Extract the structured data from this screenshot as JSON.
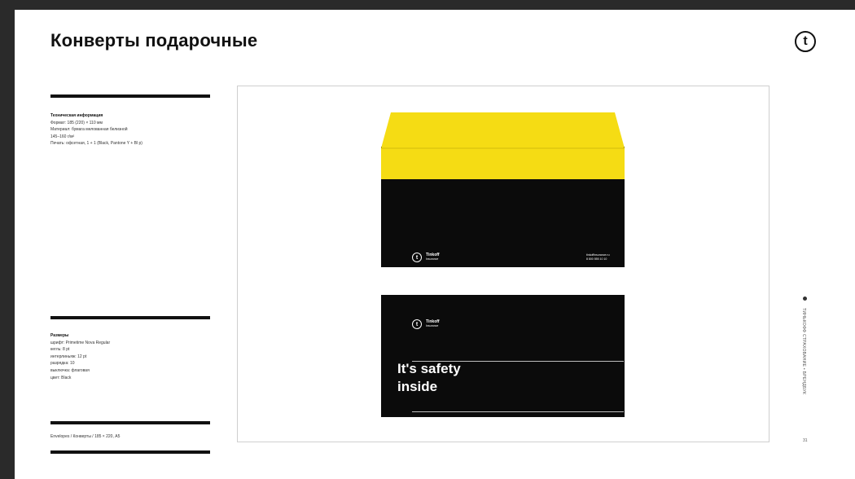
{
  "header": {
    "title": "Конверты подарочные",
    "brand_letter": "t"
  },
  "spec": {
    "heading": "Техническая информация",
    "lines": [
      "Формат: 185 (220) × 110 мм",
      "Материал: бумага мелованная белизной",
      "145–160 г/м²",
      "Печать: офсетная, 1 + 1 (Black, Pantone Y + Bl p)"
    ]
  },
  "typography": {
    "heading": "Размеры",
    "lines": [
      "шрифт: Primetime Nova Regular",
      "кегль: 8 pt",
      "интерлиньяж: 12 pt",
      "разрядка: 10",
      "выключка: флаговая",
      "цвет: Black"
    ]
  },
  "footer_note": "Envelopes / Конверты / 185 × 220, A5",
  "envelope": {
    "brand_name": "Tinkoff",
    "brand_sub": "Insurance",
    "contact_line1": "tinkoffinsurance.ru",
    "contact_line2": "8 800 555 10 10",
    "slogan_line1": "It's safety",
    "slogan_line2": "inside",
    "flap_color": "#f5dc14",
    "body_color": "#0b0b0b"
  },
  "sidebar": {
    "vertical_text": "ТИНЬКОФФ СТРАХОВАНИЕ • БРЕНДБУК",
    "page_number": "31"
  }
}
